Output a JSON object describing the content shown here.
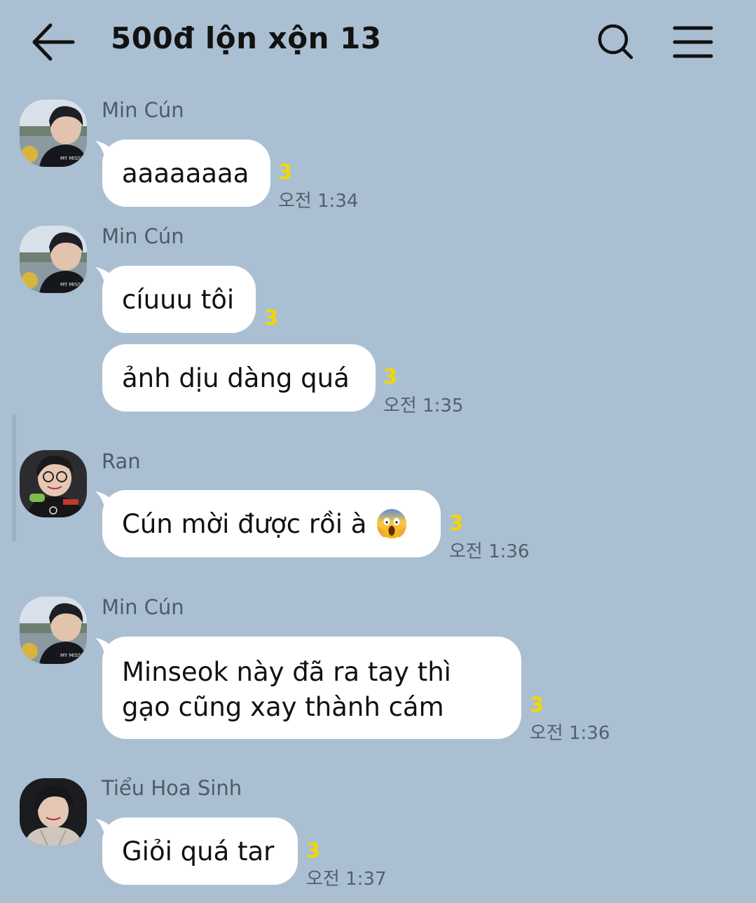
{
  "header": {
    "title": "500đ lộn xộn 13",
    "back_icon": "arrow-left-icon",
    "search_icon": "search-icon",
    "menu_icon": "hamburger-menu-icon"
  },
  "colors": {
    "background": "#aabfd2",
    "bubble": "#ffffff",
    "unread": "#f3d600"
  },
  "messages": [
    {
      "sender": "Min Cún",
      "text": "aaaaaaaa",
      "unread": "3",
      "time": "오전 1:34"
    },
    {
      "sender": "Min Cún",
      "text": "cíuuu tôi",
      "unread": "3"
    },
    {
      "text": "ảnh dịu dàng quá",
      "unread": "3",
      "time": "오전 1:35"
    },
    {
      "sender": "Ran",
      "text": "Cún mời được rồi à",
      "emoji": "face-screaming-in-fear",
      "unread": "3",
      "time": "오전 1:36"
    },
    {
      "sender": "Min Cún",
      "lines": [
        "Minseok này đã ra tay thì",
        "gạo cũng xay thành cám"
      ],
      "unread": "3",
      "time": "오전 1:36"
    },
    {
      "sender": "Tiểu Hoa Sinh",
      "text": "Giỏi quá tar",
      "unread": "3",
      "time": "오전 1:37"
    }
  ]
}
